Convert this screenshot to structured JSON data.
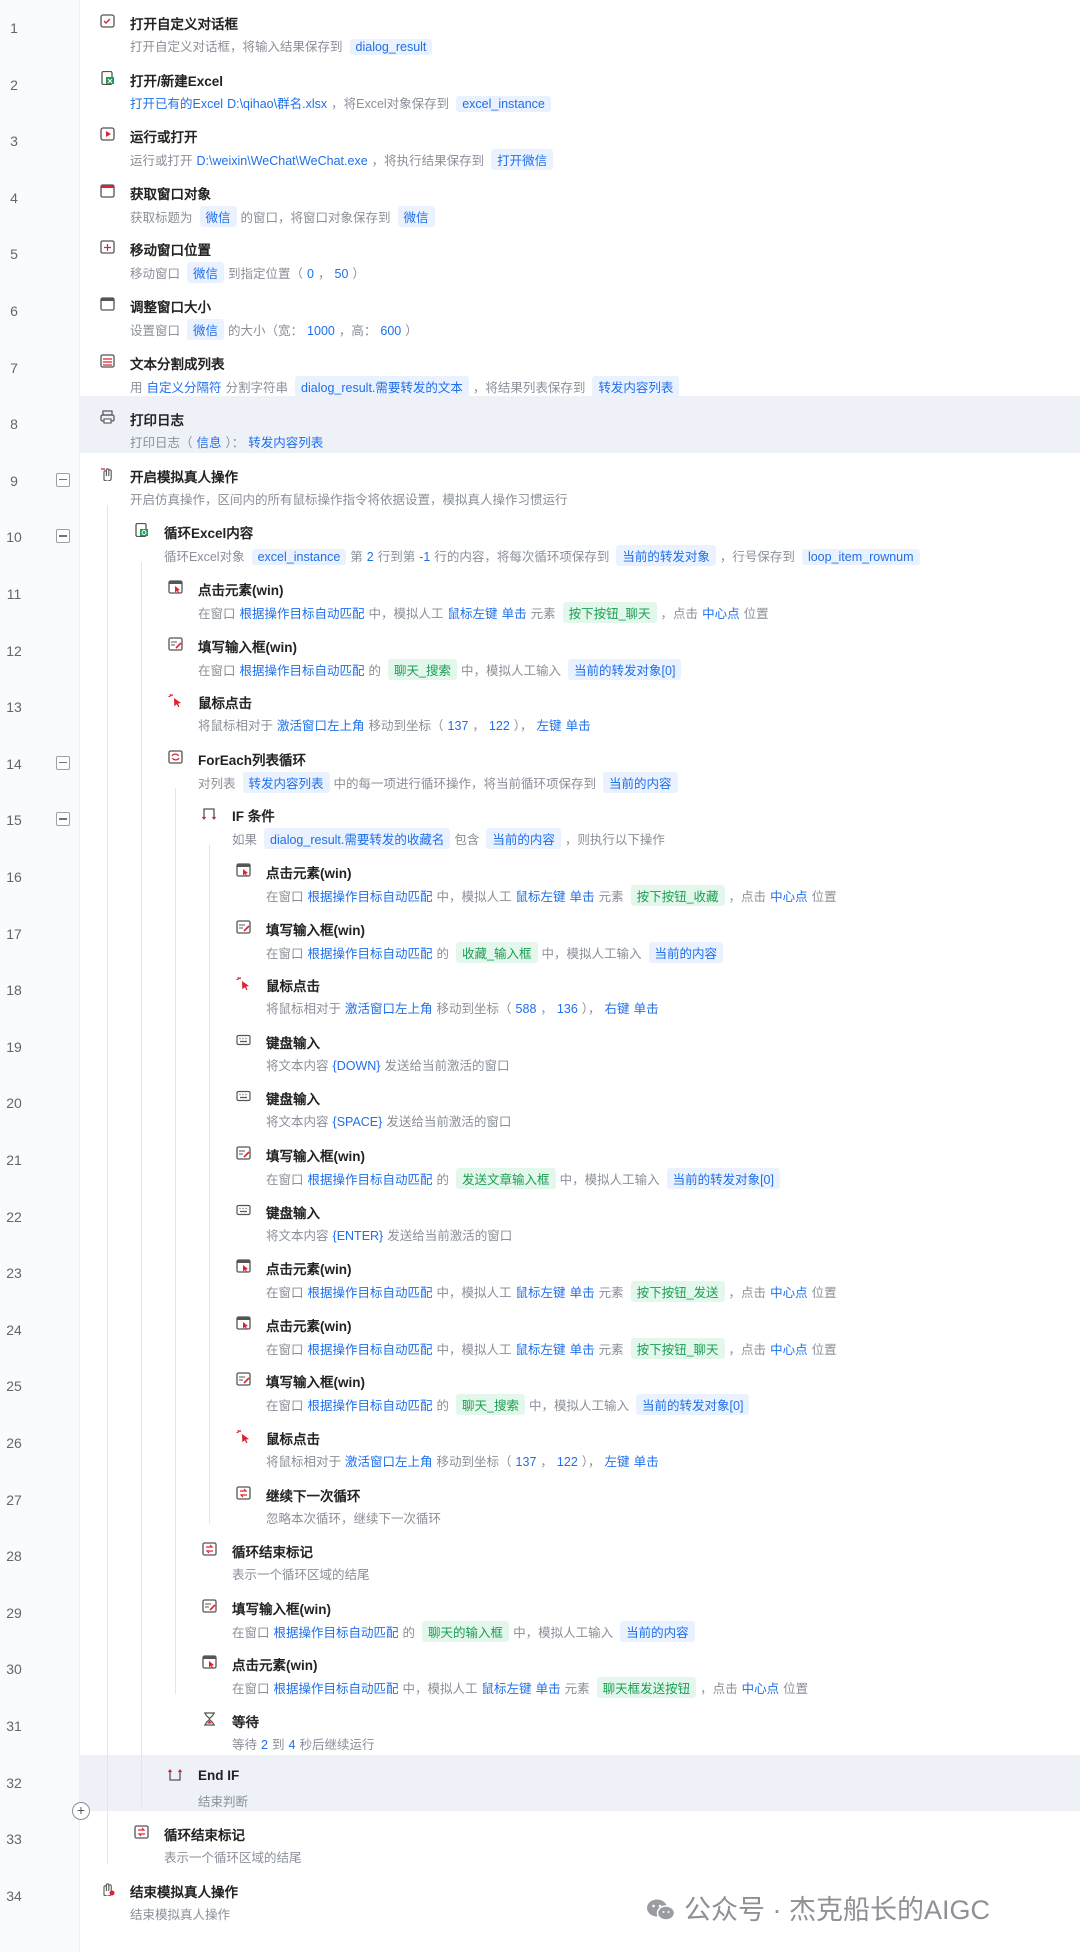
{
  "colors": {
    "accent": "#1f6feb",
    "tag_bg": "#eaf2ff",
    "green": "#1a9f52",
    "green_bg": "#e4f7ec",
    "highlight": "#eef1f7"
  },
  "rows": [
    {
      "n": "1",
      "title": "打开自定义对话框",
      "icon": "dialog-icon",
      "desc": [
        [
          "打开自定义对话框，将输入结果保存到",
          ""
        ],
        [
          "dialog_result",
          "tag"
        ]
      ]
    },
    {
      "n": "2",
      "title": "打开/新建Excel",
      "icon": "excel-icon",
      "desc": [
        [
          "打开已有的Excel",
          "v"
        ],
        [
          "D:\\qihao\\群名.xlsx",
          "v"
        ],
        [
          "，将Excel对象保存到",
          ""
        ],
        [
          "excel_instance",
          "tag"
        ]
      ]
    },
    {
      "n": "3",
      "title": "运行或打开",
      "icon": "run-icon",
      "desc": [
        [
          "运行或打开",
          ""
        ],
        [
          "D:\\weixin\\WeChat\\WeChat.exe",
          "v"
        ],
        [
          "，将执行结果保存到",
          ""
        ],
        [
          "打开微信",
          "tag"
        ]
      ]
    },
    {
      "n": "4",
      "title": "获取窗口对象",
      "icon": "window-icon",
      "desc": [
        [
          "获取标题为",
          ""
        ],
        [
          "微信",
          "tag"
        ],
        [
          "的窗口，将窗口对象保存到",
          ""
        ],
        [
          "微信",
          "tag"
        ]
      ]
    },
    {
      "n": "5",
      "title": "移动窗口位置",
      "icon": "window-move-icon",
      "desc": [
        [
          "移动窗口",
          ""
        ],
        [
          "微信",
          "tag"
        ],
        [
          "到指定位置（",
          ""
        ],
        [
          "0",
          "v"
        ],
        [
          "，",
          ""
        ],
        [
          "50",
          "v"
        ],
        [
          "）",
          ""
        ]
      ]
    },
    {
      "n": "6",
      "title": "调整窗口大小",
      "icon": "window-resize-icon",
      "desc": [
        [
          "设置窗口",
          ""
        ],
        [
          "微信",
          "tag"
        ],
        [
          "的大小（宽：",
          ""
        ],
        [
          "1000",
          "v"
        ],
        [
          "，高：",
          ""
        ],
        [
          "600",
          "v"
        ],
        [
          "）",
          ""
        ]
      ]
    },
    {
      "n": "7",
      "title": "文本分割成列表",
      "icon": "split-icon",
      "desc": [
        [
          "用",
          ""
        ],
        [
          "自定义分隔符",
          "v"
        ],
        [
          "分割字符串",
          ""
        ],
        [
          "dialog_result.需要转发的文本",
          "tag"
        ],
        [
          "，将结果列表保存到",
          ""
        ],
        [
          "转发内容列表",
          "tag"
        ]
      ]
    },
    {
      "n": "8",
      "title": "打印日志",
      "icon": "print-icon",
      "hl": true,
      "desc": [
        [
          "打印日志（",
          ""
        ],
        [
          "信息",
          "v"
        ],
        [
          "）：",
          ""
        ],
        [
          "转发内容列表",
          "v"
        ]
      ]
    },
    {
      "n": "9",
      "title": "开启模拟真人操作",
      "icon": "hand-icon",
      "fold": true,
      "desc": [
        [
          "开启仿真操作，区间内的所有鼠标操作指令将依据设置，模拟真人操作习惯运行",
          ""
        ]
      ]
    },
    {
      "n": "10",
      "title": "循环Excel内容",
      "icon": "excel-loop-icon",
      "fold": true,
      "desc": [
        [
          "循环Excel对象",
          ""
        ],
        [
          "excel_instance",
          "tag"
        ],
        [
          "第",
          ""
        ],
        [
          "2",
          "v"
        ],
        [
          "行到第",
          ""
        ],
        [
          "-1",
          "v"
        ],
        [
          "行的内容，将每次循环项保存到",
          ""
        ],
        [
          "当前的转发对象",
          "tag"
        ],
        [
          "，行号保存到",
          ""
        ],
        [
          "loop_item_rownum",
          "tag"
        ]
      ]
    },
    {
      "n": "11",
      "title": "点击元素(win)",
      "icon": "click-element-icon",
      "desc": [
        [
          "在窗口",
          ""
        ],
        [
          "根据操作目标自动匹配",
          "v"
        ],
        [
          "中，模拟人工",
          ""
        ],
        [
          "鼠标左键",
          "v"
        ],
        [
          "单击",
          "v"
        ],
        [
          "元素",
          ""
        ],
        [
          "按下按钮_聊天",
          "gtag"
        ],
        [
          "，点击",
          ""
        ],
        [
          "中心点",
          "v"
        ],
        [
          "位置",
          ""
        ]
      ]
    },
    {
      "n": "12",
      "title": "填写输入框(win)",
      "icon": "input-icon",
      "desc": [
        [
          "在窗口",
          ""
        ],
        [
          "根据操作目标自动匹配",
          "v"
        ],
        [
          "的",
          ""
        ],
        [
          "聊天_搜索",
          "gtag"
        ],
        [
          "中，模拟人工输入",
          ""
        ],
        [
          "当前的转发对象[0]",
          "tag"
        ]
      ]
    },
    {
      "n": "13",
      "title": "鼠标点击",
      "icon": "mouse-click-icon",
      "desc": [
        [
          "将鼠标相对于",
          ""
        ],
        [
          "激活窗口左上角",
          "v"
        ],
        [
          "移动到坐标（",
          ""
        ],
        [
          "137",
          "v"
        ],
        [
          "，",
          ""
        ],
        [
          "122",
          "v"
        ],
        [
          "），",
          ""
        ],
        [
          "左键",
          "v"
        ],
        [
          "单击",
          "v"
        ]
      ]
    },
    {
      "n": "14",
      "title": "ForEach列表循环",
      "icon": "foreach-icon",
      "fold": true,
      "desc": [
        [
          "对列表",
          ""
        ],
        [
          "转发内容列表",
          "tag"
        ],
        [
          "中的每一项进行循环操作，将当前循环项保存到",
          ""
        ],
        [
          "当前的内容",
          "tag"
        ]
      ]
    },
    {
      "n": "15",
      "title": "IF 条件",
      "icon": "if-icon",
      "fold": true,
      "desc": [
        [
          "如果",
          ""
        ],
        [
          "dialog_result.需要转发的收藏名",
          "tag"
        ],
        [
          "包含",
          ""
        ],
        [
          "当前的内容",
          "tag"
        ],
        [
          "，则执行以下操作",
          ""
        ]
      ]
    },
    {
      "n": "16",
      "title": "点击元素(win)",
      "icon": "click-element-icon",
      "desc": [
        [
          "在窗口",
          ""
        ],
        [
          "根据操作目标自动匹配",
          "v"
        ],
        [
          "中，模拟人工",
          ""
        ],
        [
          "鼠标左键",
          "v"
        ],
        [
          "单击",
          "v"
        ],
        [
          "元素",
          ""
        ],
        [
          "按下按钮_收藏",
          "gtag"
        ],
        [
          "，点击",
          ""
        ],
        [
          "中心点",
          "v"
        ],
        [
          "位置",
          ""
        ]
      ]
    },
    {
      "n": "17",
      "title": "填写输入框(win)",
      "icon": "input-icon",
      "desc": [
        [
          "在窗口",
          ""
        ],
        [
          "根据操作目标自动匹配",
          "v"
        ],
        [
          "的",
          ""
        ],
        [
          "收藏_输入框",
          "gtag"
        ],
        [
          "中，模拟人工输入",
          ""
        ],
        [
          "当前的内容",
          "tag"
        ]
      ]
    },
    {
      "n": "18",
      "title": "鼠标点击",
      "icon": "mouse-click-icon",
      "desc": [
        [
          "将鼠标相对于",
          ""
        ],
        [
          "激活窗口左上角",
          "v"
        ],
        [
          "移动到坐标（",
          ""
        ],
        [
          "588",
          "v"
        ],
        [
          "，",
          ""
        ],
        [
          "136",
          "v"
        ],
        [
          "），",
          ""
        ],
        [
          "右键",
          "v"
        ],
        [
          "单击",
          "v"
        ]
      ]
    },
    {
      "n": "19",
      "title": "键盘输入",
      "icon": "keyboard-icon",
      "desc": [
        [
          "将文本内容",
          ""
        ],
        [
          "{DOWN}",
          "v"
        ],
        [
          "发送给当前激活的窗口",
          ""
        ]
      ]
    },
    {
      "n": "20",
      "title": "键盘输入",
      "icon": "keyboard-icon",
      "desc": [
        [
          "将文本内容",
          ""
        ],
        [
          "{SPACE}",
          "v"
        ],
        [
          "发送给当前激活的窗口",
          ""
        ]
      ]
    },
    {
      "n": "21",
      "title": "填写输入框(win)",
      "icon": "input-icon",
      "desc": [
        [
          "在窗口",
          ""
        ],
        [
          "根据操作目标自动匹配",
          "v"
        ],
        [
          "的",
          ""
        ],
        [
          "发送文章输入框",
          "gtag"
        ],
        [
          "中，模拟人工输入",
          ""
        ],
        [
          "当前的转发对象[0]",
          "tag"
        ]
      ]
    },
    {
      "n": "22",
      "title": "键盘输入",
      "icon": "keyboard-icon",
      "desc": [
        [
          "将文本内容",
          ""
        ],
        [
          "{ENTER}",
          "v"
        ],
        [
          "发送给当前激活的窗口",
          ""
        ]
      ]
    },
    {
      "n": "23",
      "title": "点击元素(win)",
      "icon": "click-element-icon",
      "desc": [
        [
          "在窗口",
          ""
        ],
        [
          "根据操作目标自动匹配",
          "v"
        ],
        [
          "中，模拟人工",
          ""
        ],
        [
          "鼠标左键",
          "v"
        ],
        [
          "单击",
          "v"
        ],
        [
          "元素",
          ""
        ],
        [
          "按下按钮_发送",
          "gtag"
        ],
        [
          "，点击",
          ""
        ],
        [
          "中心点",
          "v"
        ],
        [
          "位置",
          ""
        ]
      ]
    },
    {
      "n": "24",
      "title": "点击元素(win)",
      "icon": "click-element-icon",
      "desc": [
        [
          "在窗口",
          ""
        ],
        [
          "根据操作目标自动匹配",
          "v"
        ],
        [
          "中，模拟人工",
          ""
        ],
        [
          "鼠标左键",
          "v"
        ],
        [
          "单击",
          "v"
        ],
        [
          "元素",
          ""
        ],
        [
          "按下按钮_聊天",
          "gtag"
        ],
        [
          "，点击",
          ""
        ],
        [
          "中心点",
          "v"
        ],
        [
          "位置",
          ""
        ]
      ]
    },
    {
      "n": "25",
      "title": "填写输入框(win)",
      "icon": "input-icon",
      "desc": [
        [
          "在窗口",
          ""
        ],
        [
          "根据操作目标自动匹配",
          "v"
        ],
        [
          "的",
          ""
        ],
        [
          "聊天_搜索",
          "gtag"
        ],
        [
          "中，模拟人工输入",
          ""
        ],
        [
          "当前的转发对象[0]",
          "tag"
        ]
      ]
    },
    {
      "n": "26",
      "title": "鼠标点击",
      "icon": "mouse-click-icon",
      "desc": [
        [
          "将鼠标相对于",
          ""
        ],
        [
          "激活窗口左上角",
          "v"
        ],
        [
          "移动到坐标（",
          ""
        ],
        [
          "137",
          "v"
        ],
        [
          "，",
          ""
        ],
        [
          "122",
          "v"
        ],
        [
          "），",
          ""
        ],
        [
          "左键",
          "v"
        ],
        [
          "单击",
          "v"
        ]
      ]
    },
    {
      "n": "27",
      "title": "继续下一次循环",
      "icon": "continue-icon",
      "desc": [
        [
          "忽略本次循环，继续下一次循环",
          ""
        ]
      ]
    },
    {
      "n": "28",
      "title": "循环结束标记",
      "icon": "loop-end-icon",
      "desc": [
        [
          "表示一个循环区域的结尾",
          ""
        ]
      ]
    },
    {
      "n": "29",
      "title": "填写输入框(win)",
      "icon": "input-icon",
      "desc": [
        [
          "在窗口",
          ""
        ],
        [
          "根据操作目标自动匹配",
          "v"
        ],
        [
          "的",
          ""
        ],
        [
          "聊天的输入框",
          "gtag"
        ],
        [
          "中，模拟人工输入",
          ""
        ],
        [
          "当前的内容",
          "tag"
        ]
      ]
    },
    {
      "n": "30",
      "title": "点击元素(win)",
      "icon": "click-element-icon",
      "desc": [
        [
          "在窗口",
          ""
        ],
        [
          "根据操作目标自动匹配",
          "v"
        ],
        [
          "中，模拟人工",
          ""
        ],
        [
          "鼠标左键",
          "v"
        ],
        [
          "单击",
          "v"
        ],
        [
          "元素",
          ""
        ],
        [
          "聊天框发送按钮",
          "gtag"
        ],
        [
          "，点击",
          ""
        ],
        [
          "中心点",
          "v"
        ],
        [
          "位置",
          ""
        ]
      ]
    },
    {
      "n": "31",
      "title": "等待",
      "icon": "hourglass-icon",
      "desc": [
        [
          "等待",
          ""
        ],
        [
          "2",
          "v"
        ],
        [
          "到",
          ""
        ],
        [
          "4",
          "v"
        ],
        [
          "秒后继续运行",
          ""
        ]
      ]
    },
    {
      "n": "32",
      "title": "End IF",
      "icon": "end-if-icon",
      "hl": true,
      "desc": [
        [
          "结束判断",
          ""
        ]
      ]
    },
    {
      "n": "33",
      "title": "循环结束标记",
      "icon": "loop-end-icon",
      "desc": [
        [
          "表示一个循环区域的结尾",
          ""
        ]
      ]
    },
    {
      "n": "34",
      "title": "结束模拟真人操作",
      "icon": "hand-end-icon",
      "desc": [
        [
          "结束模拟真人操作",
          ""
        ]
      ]
    }
  ],
  "watermark": {
    "text": "公众号 · 杰克船长的AIGC",
    "icon": "wechat-icon"
  }
}
